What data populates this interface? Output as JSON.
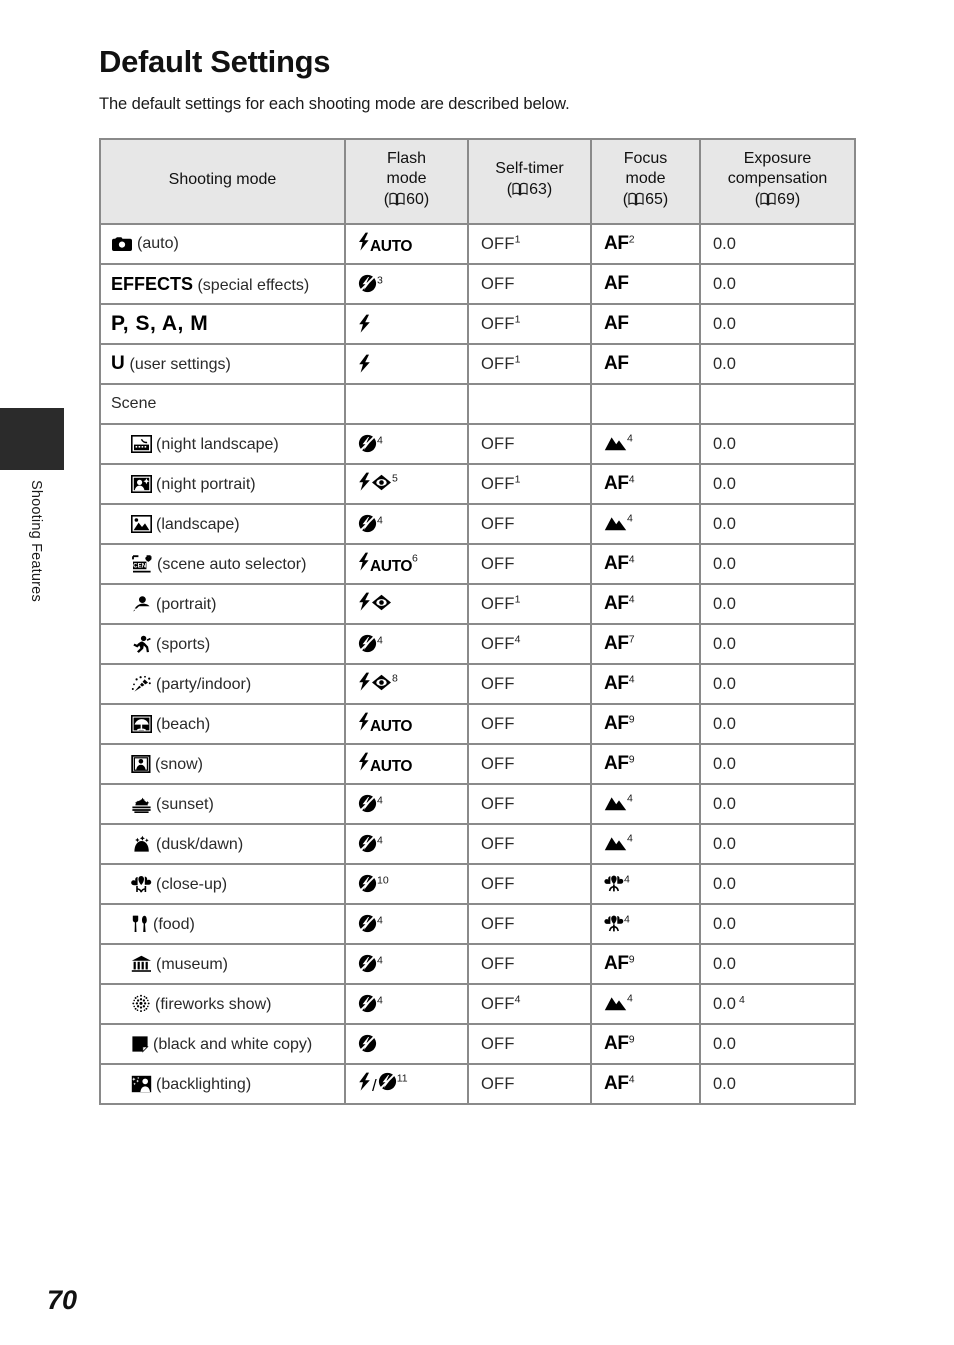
{
  "sidebar": {
    "tab_label": "Shooting Features"
  },
  "page": {
    "title": "Default Settings",
    "intro": "The default settings for each shooting mode are described below.",
    "page_number": "70"
  },
  "table": {
    "headers": [
      {
        "label": "Shooting mode",
        "ref": ""
      },
      {
        "label": "Flash mode",
        "ref": "60"
      },
      {
        "label": "Self-timer",
        "ref": "63"
      },
      {
        "label": "Focus mode",
        "ref": "65"
      },
      {
        "label": "Exposure compensation",
        "ref": "69"
      }
    ],
    "header_parts": {
      "h0": "Shooting mode",
      "h1_l1": "Flash",
      "h1_l2": "mode",
      "h1_ref": "60",
      "h2_l1": "Self-timer",
      "h2_ref": "63",
      "h3_l1": "Focus",
      "h3_l2": "mode",
      "h3_ref": "65",
      "h4_l1": "Exposure",
      "h4_l2": "compensation",
      "h4_ref": "69"
    },
    "scene_group_label": "Scene",
    "rows": [
      {
        "mode_icon": "camera-auto-icon",
        "mode_bold": "",
        "mode_text": "(auto)",
        "flash_icon": "flash-auto-icon",
        "flash_sup": "",
        "timer": "OFF",
        "timer_sup": "1",
        "focus": "AF",
        "focus_sup": "2",
        "focus_icon": "",
        "exposure": "0.0",
        "exposure_sup": ""
      },
      {
        "mode_icon": "",
        "mode_bold": "EFFECTS",
        "mode_text": "(special effects)",
        "flash_icon": "flash-off-icon",
        "flash_sup": "3",
        "timer": "OFF",
        "timer_sup": "",
        "focus": "AF",
        "focus_sup": "",
        "focus_icon": "",
        "exposure": "0.0",
        "exposure_sup": ""
      },
      {
        "mode_icon": "",
        "mode_bold": "P, S, A, M",
        "mode_text": "",
        "flash_icon": "flash-fill-icon",
        "flash_sup": "",
        "timer": "OFF",
        "timer_sup": "1",
        "focus": "AF",
        "focus_sup": "",
        "focus_icon": "",
        "exposure": "0.0",
        "exposure_sup": ""
      },
      {
        "mode_icon": "",
        "mode_bold": "U",
        "mode_text": "(user settings)",
        "flash_icon": "flash-fill-icon",
        "flash_sup": "",
        "timer": "OFF",
        "timer_sup": "1",
        "focus": "AF",
        "focus_sup": "",
        "focus_icon": "",
        "exposure": "0.0",
        "exposure_sup": ""
      },
      {
        "mode_icon": "night-landscape-icon",
        "mode_bold": "",
        "mode_text": "(night landscape)",
        "flash_icon": "flash-off-icon",
        "flash_sup": "4",
        "timer": "OFF",
        "timer_sup": "",
        "focus": "",
        "focus_sup": "4",
        "focus_icon": "mountain-icon",
        "exposure": "0.0",
        "exposure_sup": ""
      },
      {
        "mode_icon": "night-portrait-icon",
        "mode_bold": "",
        "mode_text": "(night portrait)",
        "flash_icon": "flash-redeye-icon",
        "flash_sup": "5",
        "timer": "OFF",
        "timer_sup": "1",
        "focus": "AF",
        "focus_sup": "4",
        "focus_icon": "",
        "exposure": "0.0",
        "exposure_sup": ""
      },
      {
        "mode_icon": "landscape-icon",
        "mode_bold": "",
        "mode_text": "(landscape)",
        "flash_icon": "flash-off-icon",
        "flash_sup": "4",
        "timer": "OFF",
        "timer_sup": "",
        "focus": "",
        "focus_sup": "4",
        "focus_icon": "mountain-icon",
        "exposure": "0.0",
        "exposure_sup": ""
      },
      {
        "mode_icon": "scene-auto-selector-icon",
        "mode_bold": "",
        "mode_text": "(scene auto selector)",
        "flash_icon": "flash-auto-icon",
        "flash_sup": "6",
        "timer": "OFF",
        "timer_sup": "",
        "focus": "AF",
        "focus_sup": "4",
        "focus_icon": "",
        "exposure": "0.0",
        "exposure_sup": ""
      },
      {
        "mode_icon": "portrait-icon",
        "mode_bold": "",
        "mode_text": "(portrait)",
        "flash_icon": "flash-redeye-icon",
        "flash_sup": "",
        "timer": "OFF",
        "timer_sup": "1",
        "focus": "AF",
        "focus_sup": "4",
        "focus_icon": "",
        "exposure": "0.0",
        "exposure_sup": ""
      },
      {
        "mode_icon": "sports-icon",
        "mode_bold": "",
        "mode_text": "(sports)",
        "flash_icon": "flash-off-icon",
        "flash_sup": "4",
        "timer": "OFF",
        "timer_sup": "4",
        "focus": "AF",
        "focus_sup": "7",
        "focus_icon": "",
        "exposure": "0.0",
        "exposure_sup": ""
      },
      {
        "mode_icon": "party-indoor-icon",
        "mode_bold": "",
        "mode_text": "(party/indoor)",
        "flash_icon": "flash-redeye-icon",
        "flash_sup": "8",
        "timer": "OFF",
        "timer_sup": "",
        "focus": "AF",
        "focus_sup": "4",
        "focus_icon": "",
        "exposure": "0.0",
        "exposure_sup": ""
      },
      {
        "mode_icon": "beach-icon",
        "mode_bold": "",
        "mode_text": "(beach)",
        "flash_icon": "flash-auto-icon",
        "flash_sup": "",
        "timer": "OFF",
        "timer_sup": "",
        "focus": "AF",
        "focus_sup": "9",
        "focus_icon": "",
        "exposure": "0.0",
        "exposure_sup": ""
      },
      {
        "mode_icon": "snow-icon",
        "mode_bold": "",
        "mode_text": "(snow)",
        "flash_icon": "flash-auto-icon",
        "flash_sup": "",
        "timer": "OFF",
        "timer_sup": "",
        "focus": "AF",
        "focus_sup": "9",
        "focus_icon": "",
        "exposure": "0.0",
        "exposure_sup": ""
      },
      {
        "mode_icon": "sunset-icon",
        "mode_bold": "",
        "mode_text": "(sunset)",
        "flash_icon": "flash-off-icon",
        "flash_sup": "4",
        "timer": "OFF",
        "timer_sup": "",
        "focus": "",
        "focus_sup": "4",
        "focus_icon": "mountain-icon",
        "exposure": "0.0",
        "exposure_sup": ""
      },
      {
        "mode_icon": "dusk-dawn-icon",
        "mode_bold": "",
        "mode_text": "(dusk/dawn)",
        "flash_icon": "flash-off-icon",
        "flash_sup": "4",
        "timer": "OFF",
        "timer_sup": "",
        "focus": "",
        "focus_sup": "4",
        "focus_icon": "mountain-icon",
        "exposure": "0.0",
        "exposure_sup": ""
      },
      {
        "mode_icon": "close-up-icon",
        "mode_bold": "",
        "mode_text": "(close-up)",
        "flash_icon": "flash-off-icon",
        "flash_sup": "10",
        "timer": "OFF",
        "timer_sup": "",
        "focus": "",
        "focus_sup": "4",
        "focus_icon": "macro-icon",
        "exposure": "0.0",
        "exposure_sup": ""
      },
      {
        "mode_icon": "food-icon",
        "mode_bold": "",
        "mode_text": "(food)",
        "flash_icon": "flash-off-icon",
        "flash_sup": "4",
        "timer": "OFF",
        "timer_sup": "",
        "focus": "",
        "focus_sup": "4",
        "focus_icon": "macro-icon",
        "exposure": "0.0",
        "exposure_sup": ""
      },
      {
        "mode_icon": "museum-icon",
        "mode_bold": "",
        "mode_text": "(museum)",
        "flash_icon": "flash-off-icon",
        "flash_sup": "4",
        "timer": "OFF",
        "timer_sup": "",
        "focus": "AF",
        "focus_sup": "9",
        "focus_icon": "",
        "exposure": "0.0",
        "exposure_sup": ""
      },
      {
        "mode_icon": "fireworks-icon",
        "mode_bold": "",
        "mode_text": "(fireworks show)",
        "flash_icon": "flash-off-icon",
        "flash_sup": "4",
        "timer": "OFF",
        "timer_sup": "4",
        "focus": "",
        "focus_sup": "4",
        "focus_icon": "mountain-icon",
        "exposure": "0.0",
        "exposure_sup": "4"
      },
      {
        "mode_icon": "bw-copy-icon",
        "mode_bold": "",
        "mode_text": "(black and white copy)",
        "flash_icon": "flash-off-icon",
        "flash_sup": "",
        "timer": "OFF",
        "timer_sup": "",
        "focus": "AF",
        "focus_sup": "9",
        "focus_icon": "",
        "exposure": "0.0",
        "exposure_sup": ""
      },
      {
        "mode_icon": "backlighting-icon",
        "mode_bold": "",
        "mode_text": "(backlighting)",
        "flash_icon": "flash-fill-or-off-icon",
        "flash_sup": "11",
        "timer": "OFF",
        "timer_sup": "",
        "focus": "AF",
        "focus_sup": "4",
        "focus_icon": "",
        "exposure": "0.0",
        "exposure_sup": ""
      }
    ]
  }
}
